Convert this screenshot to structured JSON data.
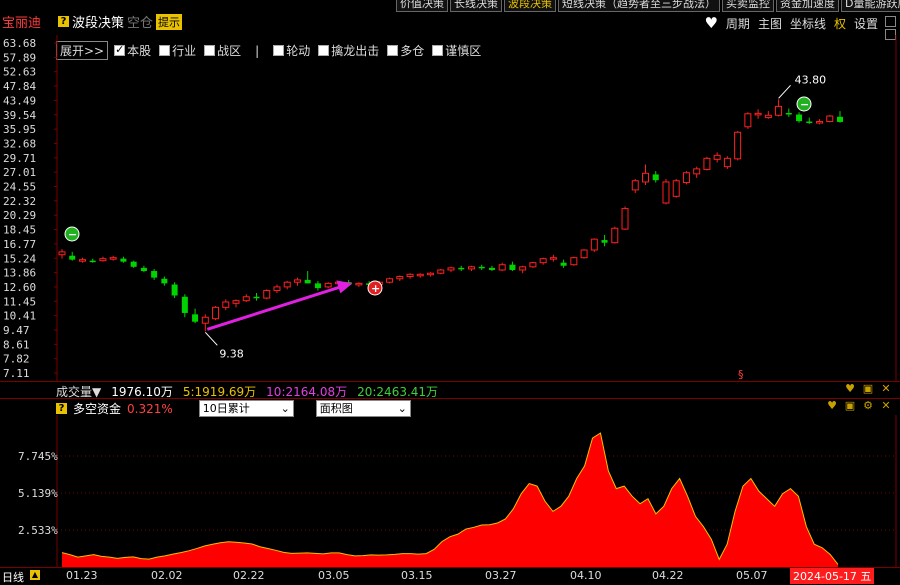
{
  "header": {
    "stock_name": "宝丽迪",
    "strategy_title": "波段决策",
    "mode_label": "空仓",
    "tip_label": "提示",
    "tabs": [
      "价值决策",
      "长线决策",
      "波段决策",
      "短线决策（趋势者至三步战法）",
      "买卖监控",
      "资金加速度",
      "D量能游跃度"
    ],
    "active_tab": 2,
    "menu": [
      "周期",
      "主图",
      "坐标线",
      "权",
      "设置"
    ]
  },
  "toolbar": {
    "expand_label": "展开>>",
    "options": [
      {
        "label": "本股",
        "checked": true
      },
      {
        "label": "行业",
        "checked": false
      },
      {
        "label": "战区",
        "checked": false
      },
      {
        "label": "轮动",
        "checked": false
      },
      {
        "label": "擒龙出击",
        "checked": false
      },
      {
        "label": "多仓",
        "checked": false
      },
      {
        "label": "谨慎区",
        "checked": false
      }
    ],
    "separator": "|"
  },
  "price_axis": [
    "63.68",
    "57.89",
    "52.63",
    "47.84",
    "43.49",
    "39.54",
    "35.95",
    "32.68",
    "29.71",
    "27.01",
    "24.55",
    "22.32",
    "20.29",
    "18.45",
    "16.77",
    "15.24",
    "13.86",
    "12.60",
    "11.45",
    "10.41",
    "9.47",
    "8.61",
    "7.82",
    "7.11"
  ],
  "annotations": {
    "low": "9.38",
    "high": "43.80",
    "marker": "§"
  },
  "colors": {
    "up": "#ff2020",
    "down": "#00d400",
    "volume_fill": "#ff0000",
    "volume_line": "#f0c000",
    "arrow": "#e020e0"
  },
  "volume_bar": {
    "label": "成交量▼",
    "value": "1976.10万",
    "ma5": "5:1919.69万",
    "ma10": "10:2164.08万",
    "ma20": "20:2463.41万"
  },
  "indicator": {
    "name": "多空资金",
    "value": "0.321%",
    "period_select": "10日累计",
    "type_select": "面积图",
    "y_ticks": [
      "7.745%",
      "5.139%",
      "2.533%"
    ]
  },
  "bottom": {
    "period_label": "日线",
    "dates": [
      "01.23",
      "02.02",
      "02.22",
      "03.05",
      "03.15",
      "03.27",
      "04.10",
      "04.22",
      "05.07"
    ],
    "current_date": "2024-05-17 五"
  },
  "candles": [
    [
      15.6,
      16.2,
      15.2,
      15.9
    ],
    [
      15.5,
      15.9,
      15.0,
      15.1
    ],
    [
      15.0,
      15.3,
      14.8,
      15.1
    ],
    [
      15.0,
      15.2,
      14.8,
      14.9
    ],
    [
      15.0,
      15.4,
      14.9,
      15.2
    ],
    [
      15.2,
      15.5,
      15.0,
      15.3
    ],
    [
      15.2,
      15.4,
      14.8,
      14.9
    ],
    [
      14.9,
      15.0,
      14.3,
      14.4
    ],
    [
      14.3,
      14.5,
      13.9,
      14.0
    ],
    [
      14.0,
      14.2,
      13.2,
      13.4
    ],
    [
      13.3,
      13.5,
      12.7,
      12.9
    ],
    [
      12.8,
      13.0,
      11.7,
      11.9
    ],
    [
      11.8,
      12.0,
      10.3,
      10.6
    ],
    [
      10.5,
      10.9,
      9.9,
      10.0
    ],
    [
      9.9,
      10.5,
      9.38,
      10.3
    ],
    [
      10.2,
      11.1,
      10.1,
      11.0
    ],
    [
      11.0,
      11.6,
      10.8,
      11.4
    ],
    [
      11.3,
      11.6,
      11.0,
      11.5
    ],
    [
      11.5,
      12.0,
      11.4,
      11.8
    ],
    [
      11.8,
      12.1,
      11.5,
      11.7
    ],
    [
      11.7,
      12.4,
      11.6,
      12.3
    ],
    [
      12.3,
      12.8,
      12.1,
      12.6
    ],
    [
      12.6,
      13.1,
      12.4,
      13.0
    ],
    [
      13.0,
      13.4,
      12.7,
      13.2
    ],
    [
      13.2,
      14.0,
      12.9,
      12.9
    ],
    [
      12.9,
      13.1,
      12.3,
      12.5
    ],
    [
      12.6,
      13.0,
      12.5,
      12.9
    ],
    [
      12.9,
      13.1,
      12.7,
      13.0
    ],
    [
      13.0,
      13.2,
      12.7,
      12.8
    ],
    [
      12.8,
      13.0,
      12.6,
      12.9
    ],
    [
      12.9,
      13.1,
      12.7,
      12.8
    ],
    [
      12.8,
      13.1,
      12.7,
      13.0
    ],
    [
      13.0,
      13.4,
      12.9,
      13.3
    ],
    [
      13.3,
      13.6,
      13.1,
      13.5
    ],
    [
      13.5,
      13.8,
      13.3,
      13.7
    ],
    [
      13.6,
      13.8,
      13.4,
      13.7
    ],
    [
      13.7,
      13.9,
      13.5,
      13.8
    ],
    [
      13.8,
      14.2,
      13.7,
      14.1
    ],
    [
      14.1,
      14.4,
      13.9,
      14.3
    ],
    [
      14.3,
      14.5,
      14.0,
      14.2
    ],
    [
      14.2,
      14.5,
      14.0,
      14.4
    ],
    [
      14.4,
      14.6,
      14.1,
      14.3
    ],
    [
      14.3,
      14.5,
      14.0,
      14.1
    ],
    [
      14.1,
      14.8,
      14.0,
      14.6
    ],
    [
      14.6,
      14.9,
      14.0,
      14.1
    ],
    [
      14.1,
      14.5,
      13.8,
      14.4
    ],
    [
      14.4,
      14.9,
      14.3,
      14.8
    ],
    [
      14.8,
      15.3,
      14.6,
      15.2
    ],
    [
      15.2,
      15.6,
      14.9,
      15.3
    ],
    [
      14.8,
      15.1,
      14.3,
      14.5
    ],
    [
      14.6,
      15.4,
      14.5,
      15.3
    ],
    [
      15.3,
      16.2,
      15.2,
      16.1
    ],
    [
      16.1,
      17.4,
      15.9,
      17.3
    ],
    [
      17.2,
      17.8,
      16.5,
      16.9
    ],
    [
      16.9,
      18.8,
      16.8,
      18.6
    ],
    [
      18.5,
      21.5,
      18.4,
      21.2
    ],
    [
      24.0,
      25.8,
      23.5,
      25.5
    ],
    [
      25.3,
      28.4,
      24.8,
      26.8
    ],
    [
      26.6,
      27.2,
      25.2,
      25.6
    ],
    [
      22.0,
      25.8,
      21.8,
      25.3
    ],
    [
      23.0,
      25.8,
      22.8,
      25.5
    ],
    [
      25.2,
      27.2,
      24.9,
      26.9
    ],
    [
      26.7,
      28.0,
      26.0,
      27.6
    ],
    [
      27.5,
      29.9,
      27.3,
      29.6
    ],
    [
      29.4,
      30.8,
      28.8,
      30.2
    ],
    [
      28.0,
      30.0,
      27.6,
      29.6
    ],
    [
      29.5,
      35.5,
      29.2,
      35.2
    ],
    [
      36.5,
      40.2,
      36.0,
      39.8
    ],
    [
      39.5,
      41.0,
      38.5,
      39.9
    ],
    [
      38.8,
      40.5,
      38.5,
      39.4
    ],
    [
      39.4,
      43.8,
      39.1,
      41.8
    ],
    [
      40.0,
      41.2,
      39.0,
      39.8
    ],
    [
      39.6,
      40.2,
      37.5,
      37.9
    ],
    [
      37.8,
      38.8,
      37.2,
      37.6
    ],
    [
      37.6,
      38.4,
      37.1,
      37.8
    ],
    [
      37.8,
      39.5,
      37.6,
      39.2
    ],
    [
      39.0,
      40.5,
      37.5,
      37.7
    ]
  ],
  "volume_series": [
    5.7,
    4.9,
    3.9,
    4.4,
    4.9,
    4.2,
    3.9,
    3.4,
    3.8,
    4.0,
    3.3,
    3.1,
    3.9,
    4.4,
    5.1,
    5.7,
    6.4,
    7.3,
    8.3,
    9.0,
    9.6,
    10.0,
    9.8,
    9.5,
    9.1,
    8.0,
    7.3,
    6.6,
    5.8,
    5.4,
    5.5,
    5.6,
    5.4,
    5.2,
    5.6,
    5.6,
    4.9,
    4.4,
    4.5,
    4.8,
    4.7,
    4.8,
    5.0,
    5.3,
    5.3,
    5.1,
    5.3,
    7.0,
    10.1,
    12.0,
    13.0,
    15.0,
    15.7,
    16.6,
    16.7,
    17.4,
    19.0,
    23.0,
    29.0,
    33.0,
    32.0,
    26.0,
    22.0,
    24.0,
    28.0,
    35.0,
    40.0,
    51.0,
    53.0,
    38.0,
    31.0,
    32.0,
    28.0,
    25.0,
    27.0,
    21.0,
    24.0,
    31.0,
    35.0,
    28.0,
    20.0,
    16.0,
    11.0,
    3.0,
    9.0,
    22.0,
    32.0,
    35.0,
    30.0,
    27.0,
    24.0,
    29.0,
    31.0,
    28.0,
    16.0,
    9.0,
    7.6,
    5.0,
    1.0
  ]
}
